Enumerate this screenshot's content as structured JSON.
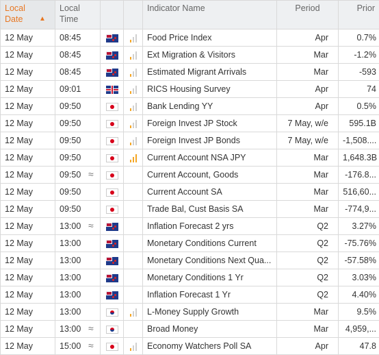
{
  "header": {
    "local_date": "Local Date",
    "local_time": "Local Time",
    "indicator_name": "Indicator Name",
    "period": "Period",
    "prior": "Prior"
  },
  "colors": {
    "accent": "#e87722",
    "impact": "#f5a623"
  },
  "rows": [
    {
      "date": "12 May",
      "time": "08:45",
      "approx": "",
      "flag": "nz",
      "impact": "low",
      "name": "Food Price Index",
      "period": "Apr",
      "prior": "0.7%"
    },
    {
      "date": "12 May",
      "time": "08:45",
      "approx": "",
      "flag": "nz",
      "impact": "low",
      "name": "Ext Migration & Visitors",
      "period": "Mar",
      "prior": "-1.2%"
    },
    {
      "date": "12 May",
      "time": "08:45",
      "approx": "",
      "flag": "nz",
      "impact": "low",
      "name": "Estimated Migrant Arrivals",
      "period": "Mar",
      "prior": "-593"
    },
    {
      "date": "12 May",
      "time": "09:01",
      "approx": "",
      "flag": "uk",
      "impact": "low",
      "name": "RICS Housing Survey",
      "period": "Apr",
      "prior": "74"
    },
    {
      "date": "12 May",
      "time": "09:50",
      "approx": "",
      "flag": "jp",
      "impact": "low",
      "name": "Bank Lending YY",
      "period": "Apr",
      "prior": "0.5%"
    },
    {
      "date": "12 May",
      "time": "09:50",
      "approx": "",
      "flag": "jp",
      "impact": "low",
      "name": "Foreign Invest JP Stock",
      "period": "7 May, w/e",
      "prior": "595.1B"
    },
    {
      "date": "12 May",
      "time": "09:50",
      "approx": "",
      "flag": "jp",
      "impact": "low",
      "name": "Foreign Invest JP Bonds",
      "period": "7 May, w/e",
      "prior": "-1,508...."
    },
    {
      "date": "12 May",
      "time": "09:50",
      "approx": "",
      "flag": "jp",
      "impact": "high",
      "name": "Current Account NSA JPY",
      "period": "Mar",
      "prior": "1,648.3B"
    },
    {
      "date": "12 May",
      "time": "09:50",
      "approx": "≈",
      "flag": "jp",
      "impact": "none",
      "name": "Current Account, Goods",
      "period": "Mar",
      "prior": "-176.8..."
    },
    {
      "date": "12 May",
      "time": "09:50",
      "approx": "",
      "flag": "jp",
      "impact": "none",
      "name": "Current Account SA",
      "period": "Mar",
      "prior": "516,60..."
    },
    {
      "date": "12 May",
      "time": "09:50",
      "approx": "",
      "flag": "jp",
      "impact": "none",
      "name": "Trade Bal, Cust Basis SA",
      "period": "Mar",
      "prior": "-774,9..."
    },
    {
      "date": "12 May",
      "time": "13:00",
      "approx": "≈",
      "flag": "nz",
      "impact": "none",
      "name": "Inflation Forecast 2 yrs",
      "period": "Q2",
      "prior": "3.27%"
    },
    {
      "date": "12 May",
      "time": "13:00",
      "approx": "",
      "flag": "nz",
      "impact": "none",
      "name": "Monetary Conditions Current",
      "period": "Q2",
      "prior": "-75.76%"
    },
    {
      "date": "12 May",
      "time": "13:00",
      "approx": "",
      "flag": "nz",
      "impact": "none",
      "name": "Monetary Conditions Next Qua...",
      "period": "Q2",
      "prior": "-57.58%"
    },
    {
      "date": "12 May",
      "time": "13:00",
      "approx": "",
      "flag": "nz",
      "impact": "none",
      "name": "Monetary Conditions 1 Yr",
      "period": "Q2",
      "prior": "3.03%"
    },
    {
      "date": "12 May",
      "time": "13:00",
      "approx": "",
      "flag": "nz",
      "impact": "none",
      "name": "Inflation Forecast 1 Yr",
      "period": "Q2",
      "prior": "4.40%"
    },
    {
      "date": "12 May",
      "time": "13:00",
      "approx": "",
      "flag": "kr",
      "impact": "low",
      "name": "L-Money Supply Growth",
      "period": "Mar",
      "prior": "9.5%"
    },
    {
      "date": "12 May",
      "time": "13:00",
      "approx": "≈",
      "flag": "kr",
      "impact": "none",
      "name": "Broad Money",
      "period": "Mar",
      "prior": "4,959,..."
    },
    {
      "date": "12 May",
      "time": "15:00",
      "approx": "≈",
      "flag": "jp",
      "impact": "low",
      "name": "Economy Watchers Poll SA",
      "period": "Apr",
      "prior": "47.8"
    }
  ]
}
